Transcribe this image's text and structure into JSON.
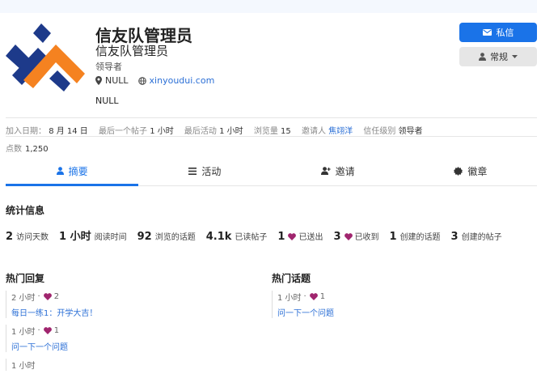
{
  "user": {
    "name": "信友队管理员",
    "full_name": "信友队管理员",
    "title": "领导者",
    "location": "NULL",
    "website": "xinyoudui.com",
    "bio": "NULL"
  },
  "buttons": {
    "message": "私信",
    "notifications": "常规"
  },
  "meta": {
    "joined_label": "加入日期：",
    "joined_value": "8 月 14 日",
    "last_post_label": "最后一个帖子",
    "last_post_value": "1 小时",
    "last_seen_label": "最后活动",
    "last_seen_value": "1 小时",
    "views_label": "浏览量",
    "views_value": "15",
    "invited_label": "邀请人",
    "invited_value": "焦翊洋",
    "trust_label": "信任级别",
    "trust_value": "领导者",
    "points_label": "点数",
    "points_value": "1,250"
  },
  "tabs": [
    {
      "label": "摘要",
      "icon": "user-icon",
      "active": true
    },
    {
      "label": "活动",
      "icon": "list-icon",
      "active": false
    },
    {
      "label": "邀请",
      "icon": "user-plus-icon",
      "active": false
    },
    {
      "label": "徽章",
      "icon": "certificate-icon",
      "active": false
    }
  ],
  "summary": {
    "title": "统计信息",
    "stats": [
      {
        "num": "2",
        "label": "访问天数"
      },
      {
        "num": "1 小时",
        "label": "阅读时间"
      },
      {
        "num": "92",
        "label": "浏览的话题"
      },
      {
        "num": "4.1k",
        "label": "已读帖子"
      },
      {
        "num": "1",
        "label": "已送出",
        "heart": true
      },
      {
        "num": "3",
        "label": "已收到",
        "heart": true
      },
      {
        "num": "1",
        "label": "创建的话题"
      },
      {
        "num": "3",
        "label": "创建的帖子"
      }
    ]
  },
  "top_replies": {
    "title": "热门回复",
    "items": [
      {
        "time": "2 小时",
        "likes": "2",
        "title": "每日一练1：开学大吉！"
      },
      {
        "time": "1 小时",
        "likes": "1",
        "title": "问一下一个问题"
      },
      {
        "time": "1 小时",
        "likes": "",
        "title": ""
      }
    ]
  },
  "top_topics": {
    "title": "热门话题",
    "items": [
      {
        "time": "1 小时",
        "likes": "1",
        "title": "问一下一个问题"
      }
    ]
  },
  "colors": {
    "accent": "#1a73e8",
    "logo_orange": "#f58220",
    "logo_navy": "#1d3a8a",
    "heart": "#a0256e",
    "link": "#2b6fd6"
  }
}
